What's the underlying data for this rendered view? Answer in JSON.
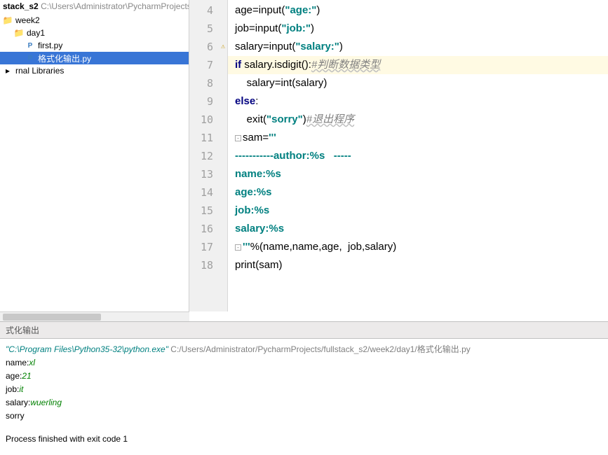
{
  "breadcrumb": {
    "project": "stack_s2",
    "path": "C:\\Users\\Administrator\\PycharmProjects"
  },
  "tree": {
    "nodes": [
      {
        "indent": 0,
        "icon": "folder",
        "label": "week2",
        "selected": false
      },
      {
        "indent": 1,
        "icon": "folder",
        "label": "day1",
        "selected": false
      },
      {
        "indent": 2,
        "icon": "py",
        "label": "first.py",
        "selected": false
      },
      {
        "indent": 2,
        "icon": "py",
        "label": "格式化输出.py",
        "selected": true
      },
      {
        "indent": 0,
        "icon": "lib",
        "label": "rnal Libraries",
        "selected": false
      }
    ]
  },
  "editor": {
    "lines": [
      {
        "n": "4",
        "hl": false,
        "tokens": [
          [
            "id",
            "age"
          ],
          [
            "op",
            "="
          ],
          [
            "fn",
            "input"
          ],
          [
            "op",
            "("
          ],
          [
            "str",
            "\"age:\""
          ],
          [
            "op",
            ")"
          ]
        ]
      },
      {
        "n": "5",
        "hl": false,
        "tokens": [
          [
            "id",
            "job"
          ],
          [
            "op",
            "="
          ],
          [
            "fn",
            "input"
          ],
          [
            "op",
            "("
          ],
          [
            "str",
            "\"job:\""
          ],
          [
            "op",
            ")"
          ]
        ]
      },
      {
        "n": "6",
        "hl": false,
        "warn": true,
        "tokens": [
          [
            "id",
            "salary"
          ],
          [
            "op",
            "="
          ],
          [
            "fn",
            "input"
          ],
          [
            "op",
            "("
          ],
          [
            "str",
            "\"salary:\""
          ],
          [
            "op",
            ")"
          ]
        ]
      },
      {
        "n": "7",
        "hl": true,
        "tokens": [
          [
            "kw",
            "if "
          ],
          [
            "id",
            "salary"
          ],
          [
            "op",
            "."
          ],
          [
            "fn",
            "isdigit"
          ],
          [
            "op",
            "():"
          ],
          [
            "cmtu",
            "#判断数据类型"
          ]
        ]
      },
      {
        "n": "8",
        "hl": false,
        "tokens": [
          [
            "id",
            "    salary"
          ],
          [
            "op",
            "="
          ],
          [
            "fn",
            "int"
          ],
          [
            "op",
            "("
          ],
          [
            "id",
            "salary"
          ],
          [
            "op",
            ")"
          ]
        ]
      },
      {
        "n": "9",
        "hl": false,
        "tokens": [
          [
            "kw",
            "else"
          ],
          [
            "op",
            ":"
          ]
        ]
      },
      {
        "n": "10",
        "hl": false,
        "tokens": [
          [
            "id",
            "    "
          ],
          [
            "fn",
            "exit"
          ],
          [
            "op",
            "("
          ],
          [
            "str",
            "\"sorry\""
          ],
          [
            "op",
            ")"
          ],
          [
            "cmtu",
            "#退出程序"
          ]
        ]
      },
      {
        "n": "11",
        "hl": false,
        "fold": true,
        "tokens": [
          [
            "id",
            "sam"
          ],
          [
            "op",
            "="
          ],
          [
            "str",
            "'''"
          ]
        ]
      },
      {
        "n": "12",
        "hl": false,
        "tokens": [
          [
            "str",
            "-----------author:%s   -----"
          ]
        ]
      },
      {
        "n": "13",
        "hl": false,
        "tokens": [
          [
            "str",
            "name:%s"
          ]
        ]
      },
      {
        "n": "14",
        "hl": false,
        "tokens": [
          [
            "str",
            "age:%s"
          ]
        ]
      },
      {
        "n": "15",
        "hl": false,
        "tokens": [
          [
            "str",
            "job:%s"
          ]
        ]
      },
      {
        "n": "16",
        "hl": false,
        "tokens": [
          [
            "str",
            "salary:%s"
          ]
        ]
      },
      {
        "n": "17",
        "hl": false,
        "fold": true,
        "tokens": [
          [
            "str",
            "'''"
          ],
          [
            "op",
            "%("
          ],
          [
            "id",
            "name"
          ],
          [
            "op",
            ","
          ],
          [
            "id",
            "name"
          ],
          [
            "op",
            ","
          ],
          [
            "id",
            "age"
          ],
          [
            "op",
            ",  "
          ],
          [
            "id",
            "job"
          ],
          [
            "op",
            ","
          ],
          [
            "id",
            "salary"
          ],
          [
            "op",
            ")"
          ]
        ]
      },
      {
        "n": "18",
        "hl": false,
        "tokens": [
          [
            "fn",
            "print"
          ],
          [
            "op",
            "("
          ],
          [
            "id",
            "sam"
          ],
          [
            "op",
            ")"
          ]
        ]
      }
    ]
  },
  "console": {
    "tab": "式化输出",
    "cmd_exe": "\"C:\\Program Files\\Python35-32\\python.exe\"",
    "cmd_script": " C:/Users/Administrator/PycharmProjects/fullstack_s2/week2/day1/格式化输出.py",
    "lines": [
      {
        "k": "name:",
        "v": "xl"
      },
      {
        "k": "age:",
        "v": "21"
      },
      {
        "k": "job:",
        "v": "it"
      },
      {
        "k": "salary:",
        "v": "wuerling"
      }
    ],
    "error": "sorry",
    "exit": "Process finished with exit code 1"
  }
}
